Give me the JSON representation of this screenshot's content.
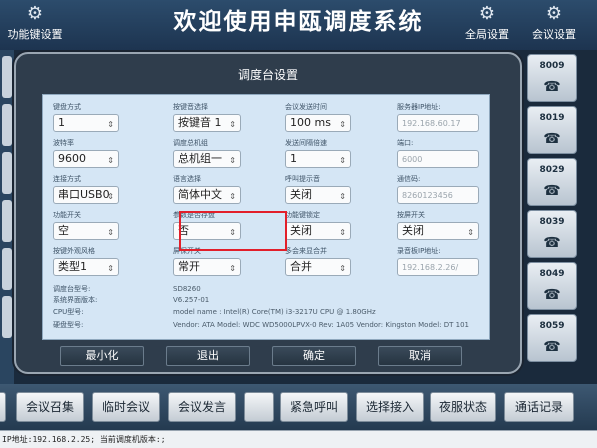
{
  "app": {
    "title": "欢迎使用申瓯调度系统",
    "left_button": "功能键设置",
    "global_settings": "全局设置",
    "conference_settings": "会议设置"
  },
  "conference_tiles": [
    "8009",
    "8019",
    "8029",
    "8039",
    "8049",
    "8059"
  ],
  "dialog": {
    "title": "调度台设置",
    "fields": {
      "f1": {
        "label": "键盘方式",
        "value": "1"
      },
      "f2": {
        "label": "按键音选择",
        "value": "按键音 1"
      },
      "f3": {
        "label": "会议发送时间",
        "value": "100 ms"
      },
      "f4": {
        "label": "服务器IP地址:",
        "value": "192.168.60.17"
      },
      "f5": {
        "label": "波特率",
        "value": "9600"
      },
      "f6": {
        "label": "调度总机组",
        "value": "总机组一"
      },
      "f7": {
        "label": "发送间隔倍速",
        "value": "1"
      },
      "f8": {
        "label": "端口:",
        "value": "6000"
      },
      "f9": {
        "label": "连接方式",
        "value": "串口USB0"
      },
      "f10": {
        "label": "语言选择",
        "value": "简体中文"
      },
      "f11": {
        "label": "呼叫提示音",
        "value": "关闭"
      },
      "f12": {
        "label": "通信码:",
        "value": "8260123456"
      },
      "f13": {
        "label": "功能开关",
        "value": "空"
      },
      "f14": {
        "label": "参数是否存盘",
        "value": "否"
      },
      "f15": {
        "label": "功能键锁定",
        "value": "关闭"
      },
      "f16": {
        "label": "按屏开关",
        "value": "关闭"
      },
      "f17": {
        "label": "按键外观风格",
        "value": "类型1"
      },
      "f18": {
        "label": "屏保开关",
        "value": "常开"
      },
      "f19": {
        "label": "多会来显合并",
        "value": "合并"
      },
      "f20": {
        "label": "录音板IP地址:",
        "value": "192.168.2.26/"
      }
    },
    "info": [
      {
        "label": "调度台型号:",
        "value": "SD8260"
      },
      {
        "label": "系统界面版本:",
        "value": "V6.257-01"
      },
      {
        "label": "CPU型号:",
        "value": "model name : Intel(R) Core(TM) i3-3217U CPU @ 1.80GHz"
      },
      {
        "label": "硬盘型号:",
        "value": "Vendor: ATA Model: WDC WD5000LPVX-0 Rev: 1A05 Vendor: Kingston Model: DT 101"
      }
    ],
    "buttons": {
      "minimize": "最小化",
      "exit": "退出",
      "confirm": "确定",
      "cancel": "取消"
    }
  },
  "bottom_buttons": [
    "会议召集",
    "临时会议",
    "会议发言",
    "紧急呼叫",
    "选择接入",
    "夜服状态",
    "通话记录"
  ],
  "status_text": "IP地址:192.168.2.25; 当前调度机版本:;"
}
